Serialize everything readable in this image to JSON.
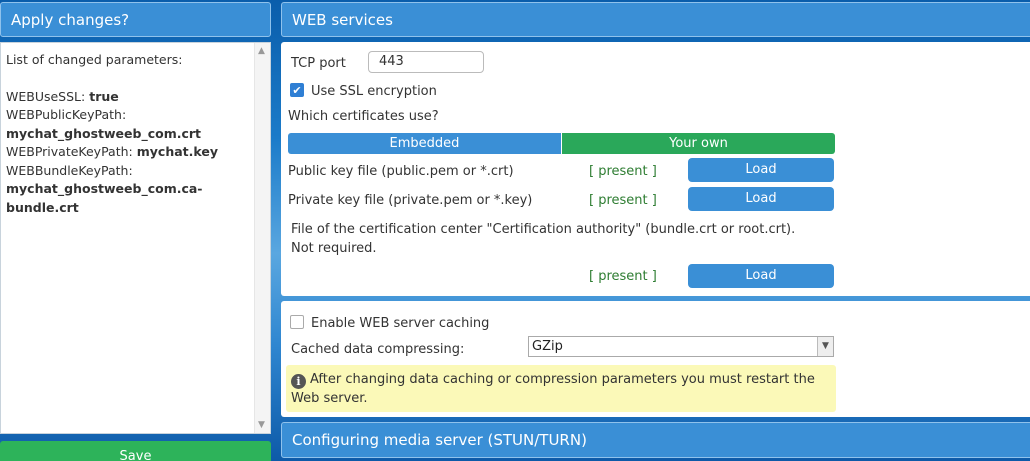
{
  "left_panel": {
    "title": "Apply changes?",
    "list_heading": "List of changed parameters:",
    "params": [
      {
        "name": "WEBUseSSL:",
        "value": "true"
      },
      {
        "name": "WEBPublicKeyPath:",
        "value": "mychat_ghostweeb_com.crt"
      },
      {
        "name": "WEBPrivateKeyPath:",
        "value": "mychat.key"
      },
      {
        "name": "WEBBundleKeyPath:",
        "value": "mychat_ghostweeb_com.ca-bundle.crt"
      }
    ],
    "save_label": "Save"
  },
  "web_services": {
    "title": "WEB services",
    "tcp_port_label": "TCP port",
    "tcp_port_value": "443",
    "use_ssl_label": "Use SSL encryption",
    "use_ssl_checked": true,
    "which_cert_label": "Which certificates use?",
    "cert_tabs": [
      "Embedded",
      "Your own"
    ],
    "public_key_label": "Public key file (public.pem or *.crt)",
    "private_key_label": "Private key file (private.pem or *.key)",
    "bundle_label_line1": "File of the certification center \"Certification authority\" (bundle.crt or root.crt).",
    "bundle_label_line2": "Not required.",
    "present_text": "[ present ]",
    "load_label": "Load"
  },
  "caching": {
    "enable_label": "Enable WEB server caching",
    "enable_checked": false,
    "compress_label": "Cached data compressing:",
    "compress_value": "GZip",
    "notice": "After changing data caching or compression parameters you must restart the Web server."
  },
  "media_server": {
    "title": "Configuring media server (STUN/TURN)"
  },
  "colors": {
    "accent": "#3a8fd6",
    "success": "#2aa85a",
    "notice_bg": "#fbf9b8"
  }
}
